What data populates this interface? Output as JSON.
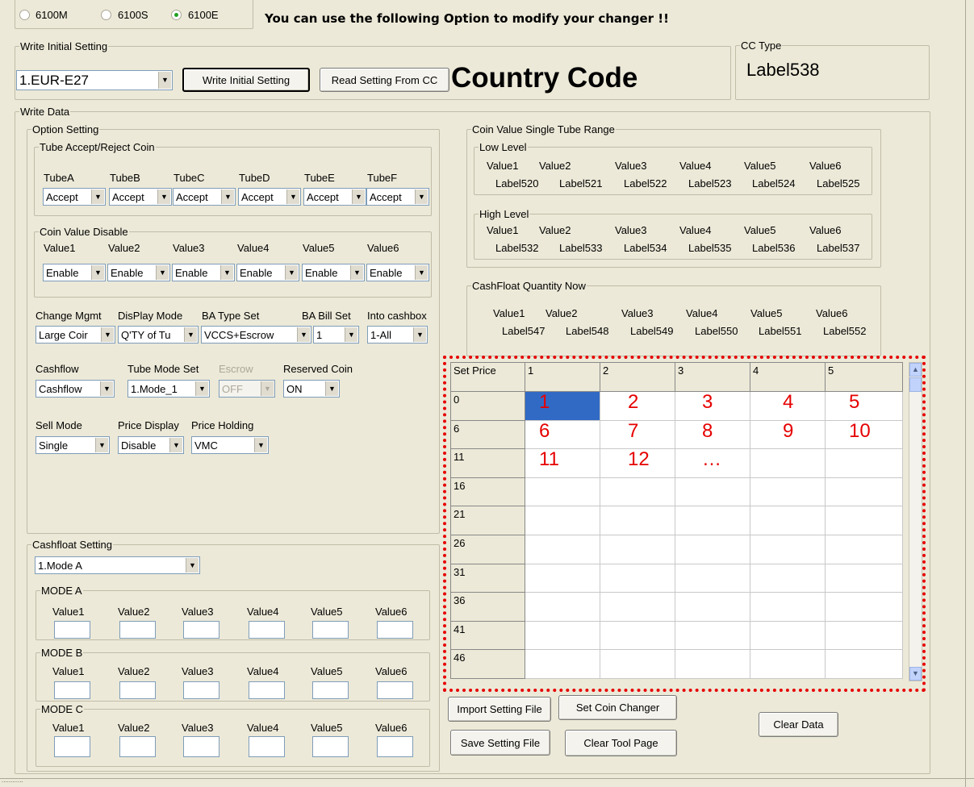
{
  "top": {
    "radios": [
      {
        "label": "6100M",
        "checked": false
      },
      {
        "label": "6100S",
        "checked": false
      },
      {
        "label": "6100E",
        "checked": true
      }
    ],
    "banner": "You can use the following Option to modify your changer !!"
  },
  "write_initial": {
    "title": "Write Initial Setting",
    "country_select": "1.EUR-E27",
    "write_button": "Write Initial Setting",
    "read_button": "Read Setting From CC",
    "country_code_label": "Country Code"
  },
  "cc_type": {
    "title": "CC Type",
    "value": "Label538"
  },
  "write_data": {
    "title": "Write Data"
  },
  "option_setting": {
    "title": "Option Setting",
    "tube_group": {
      "title": "Tube Accept/Reject Coin",
      "labels": [
        "TubeA",
        "TubeB",
        "TubeC",
        "TubeD",
        "TubeE",
        "TubeF"
      ],
      "values": [
        "Accept",
        "Accept",
        "Accept",
        "Accept",
        "Accept",
        "Accept"
      ]
    },
    "coin_disable": {
      "title": "Coin Value Disable",
      "labels": [
        "Value1",
        "Value2",
        "Value3",
        "Value4",
        "Value5",
        "Value6"
      ],
      "values": [
        "Enable",
        "Enable",
        "Enable",
        "Enable",
        "Enable",
        "Enable"
      ]
    },
    "row1": {
      "labels": [
        "Change Mgmt",
        "DisPlay Mode",
        "BA Type Set",
        "BA Bill Set",
        "Into cashbox"
      ],
      "values": [
        "Large Coir",
        "Q'TY of Tu",
        "VCCS+Escrow",
        "1",
        "1-All"
      ]
    },
    "row2": {
      "labels": [
        "Cashflow",
        "Tube Mode Set",
        "Escrow",
        "Reserved Coin"
      ],
      "values": [
        "Cashflow",
        "1.Mode_1",
        "OFF",
        "ON"
      ]
    },
    "row3": {
      "labels": [
        "Sell Mode",
        "Price Display",
        "Price Holding"
      ],
      "values": [
        "Single",
        "Disable",
        "VMC"
      ]
    }
  },
  "cashfloat_setting": {
    "title": "Cashfloat Setting",
    "mode_select": "1.Mode A",
    "modes": [
      {
        "title": "MODE A",
        "labels": [
          "Value1",
          "Value2",
          "Value3",
          "Value4",
          "Value5",
          "Value6"
        ]
      },
      {
        "title": "MODE B",
        "labels": [
          "Value1",
          "Value2",
          "Value3",
          "Value4",
          "Value5",
          "Value6"
        ]
      },
      {
        "title": "MODE C",
        "labels": [
          "Value1",
          "Value2",
          "Value3",
          "Value4",
          "Value5",
          "Value6"
        ]
      }
    ]
  },
  "coin_range": {
    "title": "Coin Value Single Tube Range",
    "low": {
      "title": "Low Level",
      "labels": [
        "Value1",
        "Value2",
        "Value3",
        "Value4",
        "Value5",
        "Value6"
      ],
      "values": [
        "Label520",
        "Label521",
        "Label522",
        "Label523",
        "Label524",
        "Label525"
      ]
    },
    "high": {
      "title": "High Level",
      "labels": [
        "Value1",
        "Value2",
        "Value3",
        "Value4",
        "Value5",
        "Value6"
      ],
      "values": [
        "Label532",
        "Label533",
        "Label534",
        "Label535",
        "Label536",
        "Label537"
      ]
    }
  },
  "cashfloat_now": {
    "title": "CashFloat Quantity Now",
    "labels": [
      "Value1",
      "Value2",
      "Value3",
      "Value4",
      "Value5",
      "Value6"
    ],
    "values": [
      "Label547",
      "Label548",
      "Label549",
      "Label550",
      "Label551",
      "Label552"
    ]
  },
  "price_grid": {
    "corner": "Set Price",
    "columns": [
      "1",
      "2",
      "3",
      "4",
      "5"
    ],
    "rows": [
      "0",
      "6",
      "11",
      "16",
      "21",
      "26",
      "31",
      "36",
      "41",
      "46"
    ],
    "annotations": [
      [
        "1",
        "2",
        "3",
        "4",
        "5"
      ],
      [
        "6",
        "7",
        "8",
        "9",
        "10"
      ],
      [
        "11",
        "12",
        "…"
      ]
    ]
  },
  "buttons": {
    "import": "Import Setting File",
    "set_coin": "Set  Coin Changer",
    "save": "Save Setting File",
    "clear_tool": "Clear Tool Page",
    "clear_data": "Clear Data"
  },
  "status": {
    "text": "............"
  },
  "colors": {
    "annotation": "#e60000",
    "selection": "#316ac5",
    "dotted_border": "#e60000"
  }
}
